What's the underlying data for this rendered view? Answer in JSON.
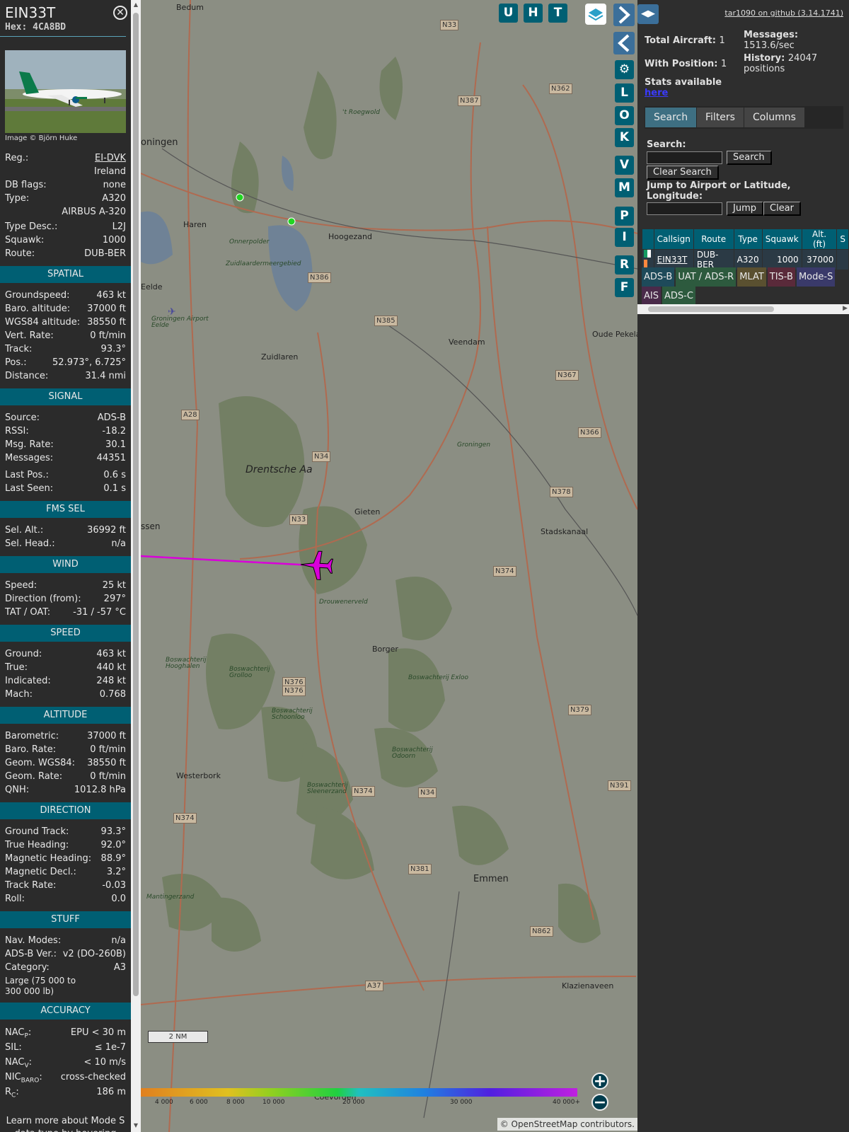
{
  "info": {
    "callsign": "EIN33T",
    "hex": "Hex: 4CA8BD",
    "photo_credit": "Image © Björn Huke",
    "general": [
      {
        "k": "Reg.:",
        "v": "EI-DVK"
      },
      {
        "k": "",
        "v": "Ireland"
      },
      {
        "k": "DB flags:",
        "v": "none"
      },
      {
        "k": "Type:",
        "v": "A320"
      },
      {
        "k": "",
        "v": "AIRBUS A-320"
      },
      {
        "k": "Type Desc.:",
        "v": "L2J"
      },
      {
        "k": "Squawk:",
        "v": "1000"
      },
      {
        "k": "Route:",
        "v": "DUB-BER"
      }
    ],
    "sections": [
      {
        "title": "SPATIAL",
        "rows": [
          {
            "k": "Groundspeed:",
            "v": "463 kt"
          },
          {
            "k": "Baro. altitude:",
            "v": "37000 ft"
          },
          {
            "k": "WGS84 altitude:",
            "v": "38550 ft"
          },
          {
            "k": "Vert. Rate:",
            "v": "0 ft/min"
          },
          {
            "k": "Track:",
            "v": "93.3°"
          },
          {
            "k": "Pos.:",
            "v": "52.973°, 6.725°"
          },
          {
            "k": "Distance:",
            "v": "31.4 nmi"
          }
        ]
      },
      {
        "title": "SIGNAL",
        "rows": [
          {
            "k": "Source:",
            "v": "ADS-B"
          },
          {
            "k": "RSSI:",
            "v": "-18.2"
          },
          {
            "k": "Msg. Rate:",
            "v": "30.1"
          },
          {
            "k": "Messages:",
            "v": "44351"
          },
          {
            "k": "Last Pos.:",
            "v": "0.6 s"
          },
          {
            "k": "Last Seen:",
            "v": "0.1 s"
          }
        ]
      },
      {
        "title": "FMS SEL",
        "rows": [
          {
            "k": "Sel. Alt.:",
            "v": "36992 ft"
          },
          {
            "k": "Sel. Head.:",
            "v": "n/a"
          }
        ]
      },
      {
        "title": "WIND",
        "rows": [
          {
            "k": "Speed:",
            "v": "25 kt"
          },
          {
            "k": "Direction (from):",
            "v": "297°"
          },
          {
            "k": "TAT / OAT:",
            "v": "-31 / -57 °C"
          }
        ]
      },
      {
        "title": "SPEED",
        "rows": [
          {
            "k": "Ground:",
            "v": "463 kt"
          },
          {
            "k": "True:",
            "v": "440 kt"
          },
          {
            "k": "Indicated:",
            "v": "248 kt"
          },
          {
            "k": "Mach:",
            "v": "0.768"
          }
        ]
      },
      {
        "title": "ALTITUDE",
        "rows": [
          {
            "k": "Barometric:",
            "v": "37000 ft"
          },
          {
            "k": "Baro. Rate:",
            "v": "0 ft/min"
          },
          {
            "k": "Geom. WGS84:",
            "v": "38550 ft"
          },
          {
            "k": "Geom. Rate:",
            "v": "0 ft/min"
          },
          {
            "k": "QNH:",
            "v": "1012.8 hPa"
          }
        ]
      },
      {
        "title": "DIRECTION",
        "rows": [
          {
            "k": "Ground Track:",
            "v": "93.3°"
          },
          {
            "k": "True Heading:",
            "v": "92.0°"
          },
          {
            "k": "Magnetic Heading:",
            "v": "88.9°"
          },
          {
            "k": "Magnetic Decl.:",
            "v": "3.2°"
          },
          {
            "k": "Track Rate:",
            "v": "-0.03"
          },
          {
            "k": "Roll:",
            "v": "0.0"
          }
        ]
      },
      {
        "title": "STUFF",
        "rows": [
          {
            "k": "Nav. Modes:",
            "v": "n/a"
          },
          {
            "k": "ADS-B Ver.:",
            "v": "v2 (DO-260B)"
          },
          {
            "k": "Category:",
            "v": "A3"
          }
        ]
      }
    ],
    "category_desc": "Large (75 000 to 300 000 lb)",
    "accuracy_title": "ACCURACY",
    "accuracy": [
      {
        "k": "NAC",
        "sub": "P",
        "v": "EPU < 30 m"
      },
      {
        "k": "SIL:",
        "sub": "",
        "v": "≤ 1e-7"
      },
      {
        "k": "NAC",
        "sub": "V",
        "v": "< 10 m/s"
      },
      {
        "k": "NIC",
        "sub": "BARO",
        "v": "cross-checked"
      },
      {
        "k": "R",
        "sub": "C",
        "v": "186 m"
      }
    ],
    "footer": "Learn more about Mode S data type by hovering over each data label."
  },
  "map": {
    "top_buttons": [
      "U",
      "H",
      "T"
    ],
    "side_buttons": [
      "L",
      "O",
      "K",
      "V",
      "M",
      "P",
      "I",
      "R",
      "F"
    ],
    "place_labels": [
      {
        "t": "Bedum"
      },
      {
        "t": "oningen"
      },
      {
        "t": "Haren"
      },
      {
        "t": "Hoogezand"
      },
      {
        "t": "Onnerpolder"
      },
      {
        "t": "Zuidlaardermeergebied"
      },
      {
        "t": "'t Roegwold"
      },
      {
        "t": "Eelde"
      },
      {
        "t": "Groningen Airport Eelde"
      },
      {
        "t": "Veendam"
      },
      {
        "t": "Zuidlaren"
      },
      {
        "t": "Oude Pekela"
      },
      {
        "t": "Drentsche Aa"
      },
      {
        "t": "Gieten"
      },
      {
        "t": "Stadskanaal"
      },
      {
        "t": "ssen"
      },
      {
        "t": "Drouwenerveld"
      },
      {
        "t": "Borger"
      },
      {
        "t": "Boswachterij Hooghalen"
      },
      {
        "t": "Boswachterij Grolloo"
      },
      {
        "t": "Boswachterij Schoonloo"
      },
      {
        "t": "Boswachterij Exloo"
      },
      {
        "t": "Boswachterij Odoorn"
      },
      {
        "t": "Westerbork"
      },
      {
        "t": "Boswachterij Sleenerzand"
      },
      {
        "t": "Emmen"
      },
      {
        "t": "Mantingerzand"
      },
      {
        "t": "Klazienaveen"
      },
      {
        "t": "Coevorden"
      },
      {
        "t": "Groningen"
      }
    ],
    "road_shields": [
      "N33",
      "N387",
      "N362",
      "N386",
      "N385",
      "N367",
      "A28",
      "N34",
      "N366",
      "N378",
      "N33",
      "N374",
      "N374",
      "N376",
      "N379",
      "N376",
      "N34",
      "N391",
      "N374",
      "N381",
      "N862",
      "A37"
    ],
    "altitude_scale": [
      "4 000",
      "6 000",
      "8 000",
      "10 000",
      "20 000",
      "30 000",
      "40 000+"
    ],
    "scale_bar": "2 NM",
    "attribution_prefix": "© ",
    "attribution_link": "OpenStreetMap",
    "attribution_suffix": " contributors."
  },
  "right": {
    "github": "tar1090 on github (3.14.1741)",
    "total_aircraft_label": "Total Aircraft:",
    "total_aircraft": "1",
    "with_position_label": "With Position:",
    "with_position": "1",
    "messages_label": "Messages:",
    "messages": "1513.6/sec",
    "history_label": "History:",
    "history": "24047 positions",
    "stats_label": "Stats available",
    "stats_link": "here",
    "tabs": [
      "Search",
      "Filters",
      "Columns"
    ],
    "search_label": "Search:",
    "search_btn": "Search",
    "clear_search_btn": "Clear Search",
    "jump_label": "Jump to Airport or Latitude, Longitude:",
    "jump_btn": "Jump",
    "clear_btn": "Clear",
    "table_headers": [
      "",
      "Callsign",
      "Route",
      "Type",
      "Squawk",
      "Alt. (ft)",
      "S"
    ],
    "table_row": [
      "",
      "EIN33T",
      "DUB-BER",
      "A320",
      "1000",
      "37000",
      ""
    ],
    "legend": [
      {
        "t": "ADS-B",
        "c": "#1e4a5a"
      },
      {
        "t": "UAT / ADS-R",
        "c": "#2d5a3e"
      },
      {
        "t": "MLAT",
        "c": "#5a5030"
      },
      {
        "t": "TIS-B",
        "c": "#5a2a3a"
      },
      {
        "t": "Mode-S",
        "c": "#3a3a6a"
      },
      {
        "t": "AIS",
        "c": "#4a2a4a"
      },
      {
        "t": "ADS-C",
        "c": "#2d5a3e"
      }
    ]
  }
}
